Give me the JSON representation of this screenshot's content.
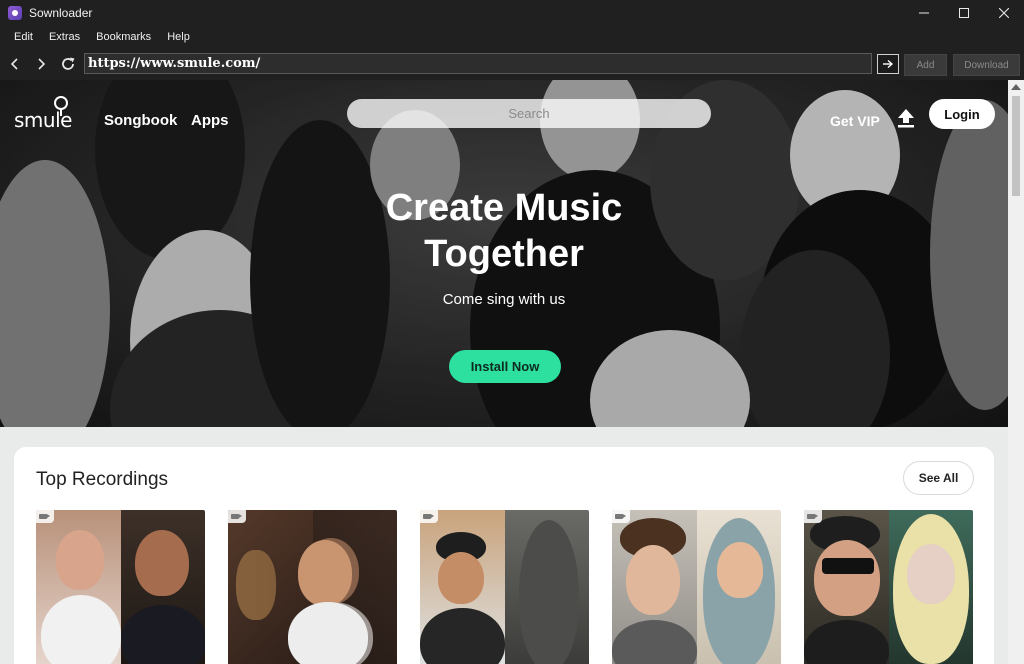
{
  "window": {
    "title": "Sownloader",
    "controls": [
      "minimize-icon",
      "maximize-icon",
      "close-icon"
    ]
  },
  "menu": {
    "items": [
      "Edit",
      "Extras",
      "Bookmarks",
      "Help"
    ]
  },
  "toolbar": {
    "url": "https://www.smule.com/",
    "add_label": "Add",
    "download_label": "Download"
  },
  "site": {
    "logo_text": "smule",
    "nav": [
      "Songbook",
      "Apps"
    ],
    "search_placeholder": "Search",
    "get_vip": "Get VIP",
    "login": "Login",
    "hero": {
      "title": "Create Music Together",
      "subtitle": "Come sing with us",
      "cta": "Install Now"
    },
    "recordings": {
      "title": "Top Recordings",
      "see_all": "See All",
      "count": 5
    }
  },
  "colors": {
    "accent_green": "#2de0a0",
    "chrome_dark": "#202020"
  }
}
